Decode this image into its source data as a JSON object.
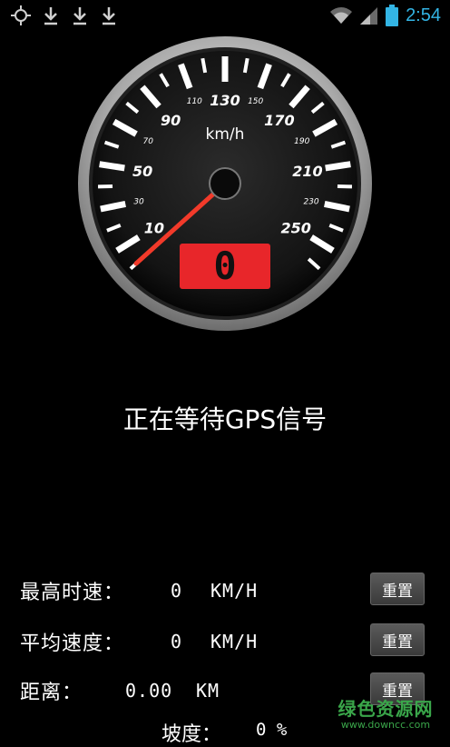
{
  "status_bar": {
    "time": "2:54",
    "icons": [
      "gps-icon",
      "download-icon",
      "download-icon",
      "download-icon",
      "wifi-icon",
      "signal-icon",
      "battery-icon"
    ],
    "time_color": "#33b5e5"
  },
  "gauge": {
    "unit": "km/h",
    "major_labels": [
      "10",
      "50",
      "90",
      "130",
      "170",
      "210",
      "250"
    ],
    "minor_labels": [
      "30",
      "70",
      "110",
      "150",
      "190",
      "230"
    ],
    "current_speed": "0",
    "needle_value": 0,
    "display_color": "#e8262a"
  },
  "status_message": "正在等待GPS信号",
  "stats": {
    "max_speed": {
      "label": "最高时速：",
      "value": "0",
      "unit": "KM/H",
      "reset": "重置"
    },
    "avg_speed": {
      "label": "平均速度：",
      "value": "0",
      "unit": "KM/H",
      "reset": "重置"
    },
    "distance": {
      "label": "距离：",
      "value": "0.00",
      "unit": "KM",
      "reset": "重置"
    },
    "slope": {
      "label": "坡度：",
      "value": "0 %"
    }
  },
  "watermark": {
    "title": "绿色资源网",
    "url": "www.downcc.com"
  }
}
